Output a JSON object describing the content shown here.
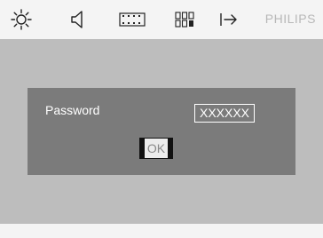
{
  "toolbar": {
    "icons": [
      "brightness-icon",
      "speaker-icon",
      "film-strip-icon",
      "grid-icon",
      "export-icon"
    ],
    "brand": "PHILIPS"
  },
  "dialog": {
    "password_label": "Password",
    "password_value": "XXXXXX",
    "ok_label": "OK"
  }
}
